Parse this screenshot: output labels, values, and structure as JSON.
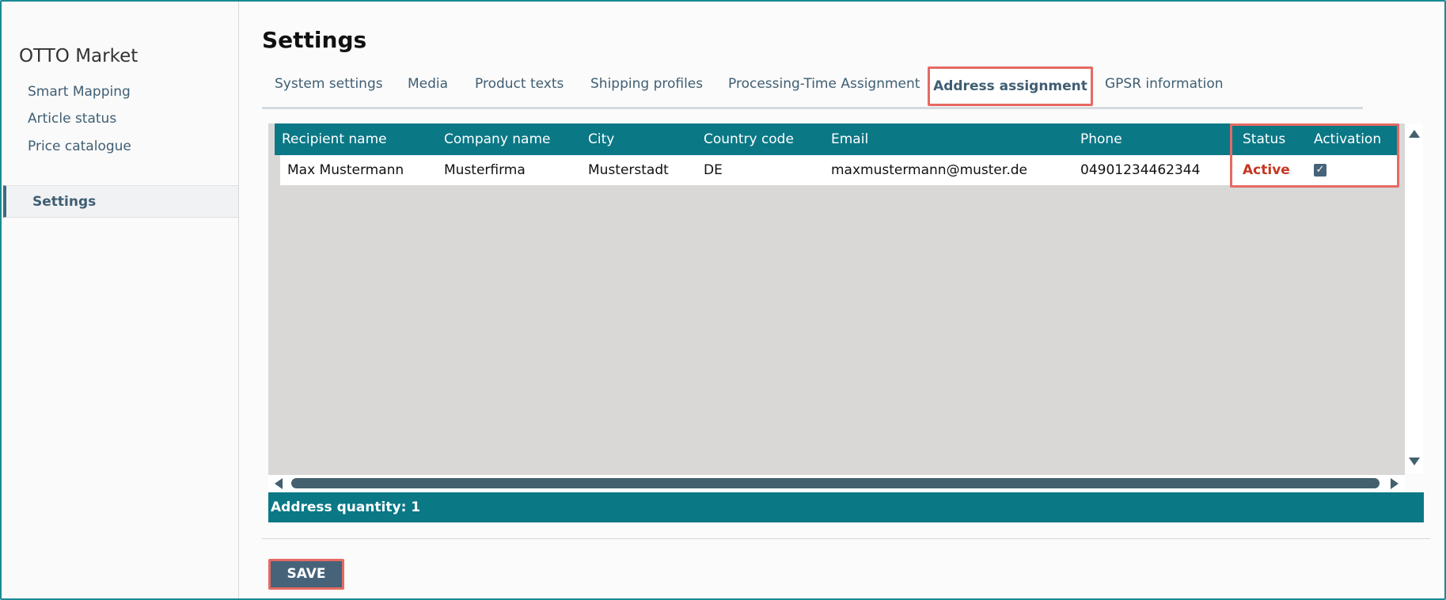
{
  "sidebar": {
    "app_title": "OTTO Market",
    "items": [
      {
        "label": "Smart Mapping"
      },
      {
        "label": "Article status"
      },
      {
        "label": "Price catalogue"
      },
      {
        "label": "Settings",
        "active": true
      }
    ]
  },
  "page": {
    "title": "Settings"
  },
  "tabs": [
    {
      "label": "System settings"
    },
    {
      "label": "Media"
    },
    {
      "label": "Product texts"
    },
    {
      "label": "Shipping profiles"
    },
    {
      "label": "Processing-Time Assignment"
    },
    {
      "label": "Address assignment",
      "active": true
    },
    {
      "label": "GPSR information"
    }
  ],
  "grid": {
    "columns": [
      "Recipient name",
      "Company name",
      "City",
      "Country code",
      "Email",
      "Phone",
      "Status",
      "Activation"
    ],
    "rows": [
      {
        "recipient_name": "Max Mustermann",
        "company_name": "Musterfirma",
        "city": "Musterstadt",
        "country_code": "DE",
        "email": "maxmustermann@muster.de",
        "phone": "04901234462344",
        "status": "Active",
        "activation_checked": true
      }
    ],
    "footer": "Address quantity: 1"
  },
  "actions": {
    "save_label": "SAVE"
  },
  "colors": {
    "header_teal": "#0b7886",
    "accent_slate": "#46637a",
    "highlight_red": "#e56a63",
    "status_active": "#c53620"
  },
  "icons": {
    "checkbox": "check-icon",
    "scroll_up": "arrow-up-icon",
    "scroll_down": "arrow-down-icon",
    "scroll_left": "arrow-left-icon",
    "scroll_right": "arrow-right-icon"
  }
}
